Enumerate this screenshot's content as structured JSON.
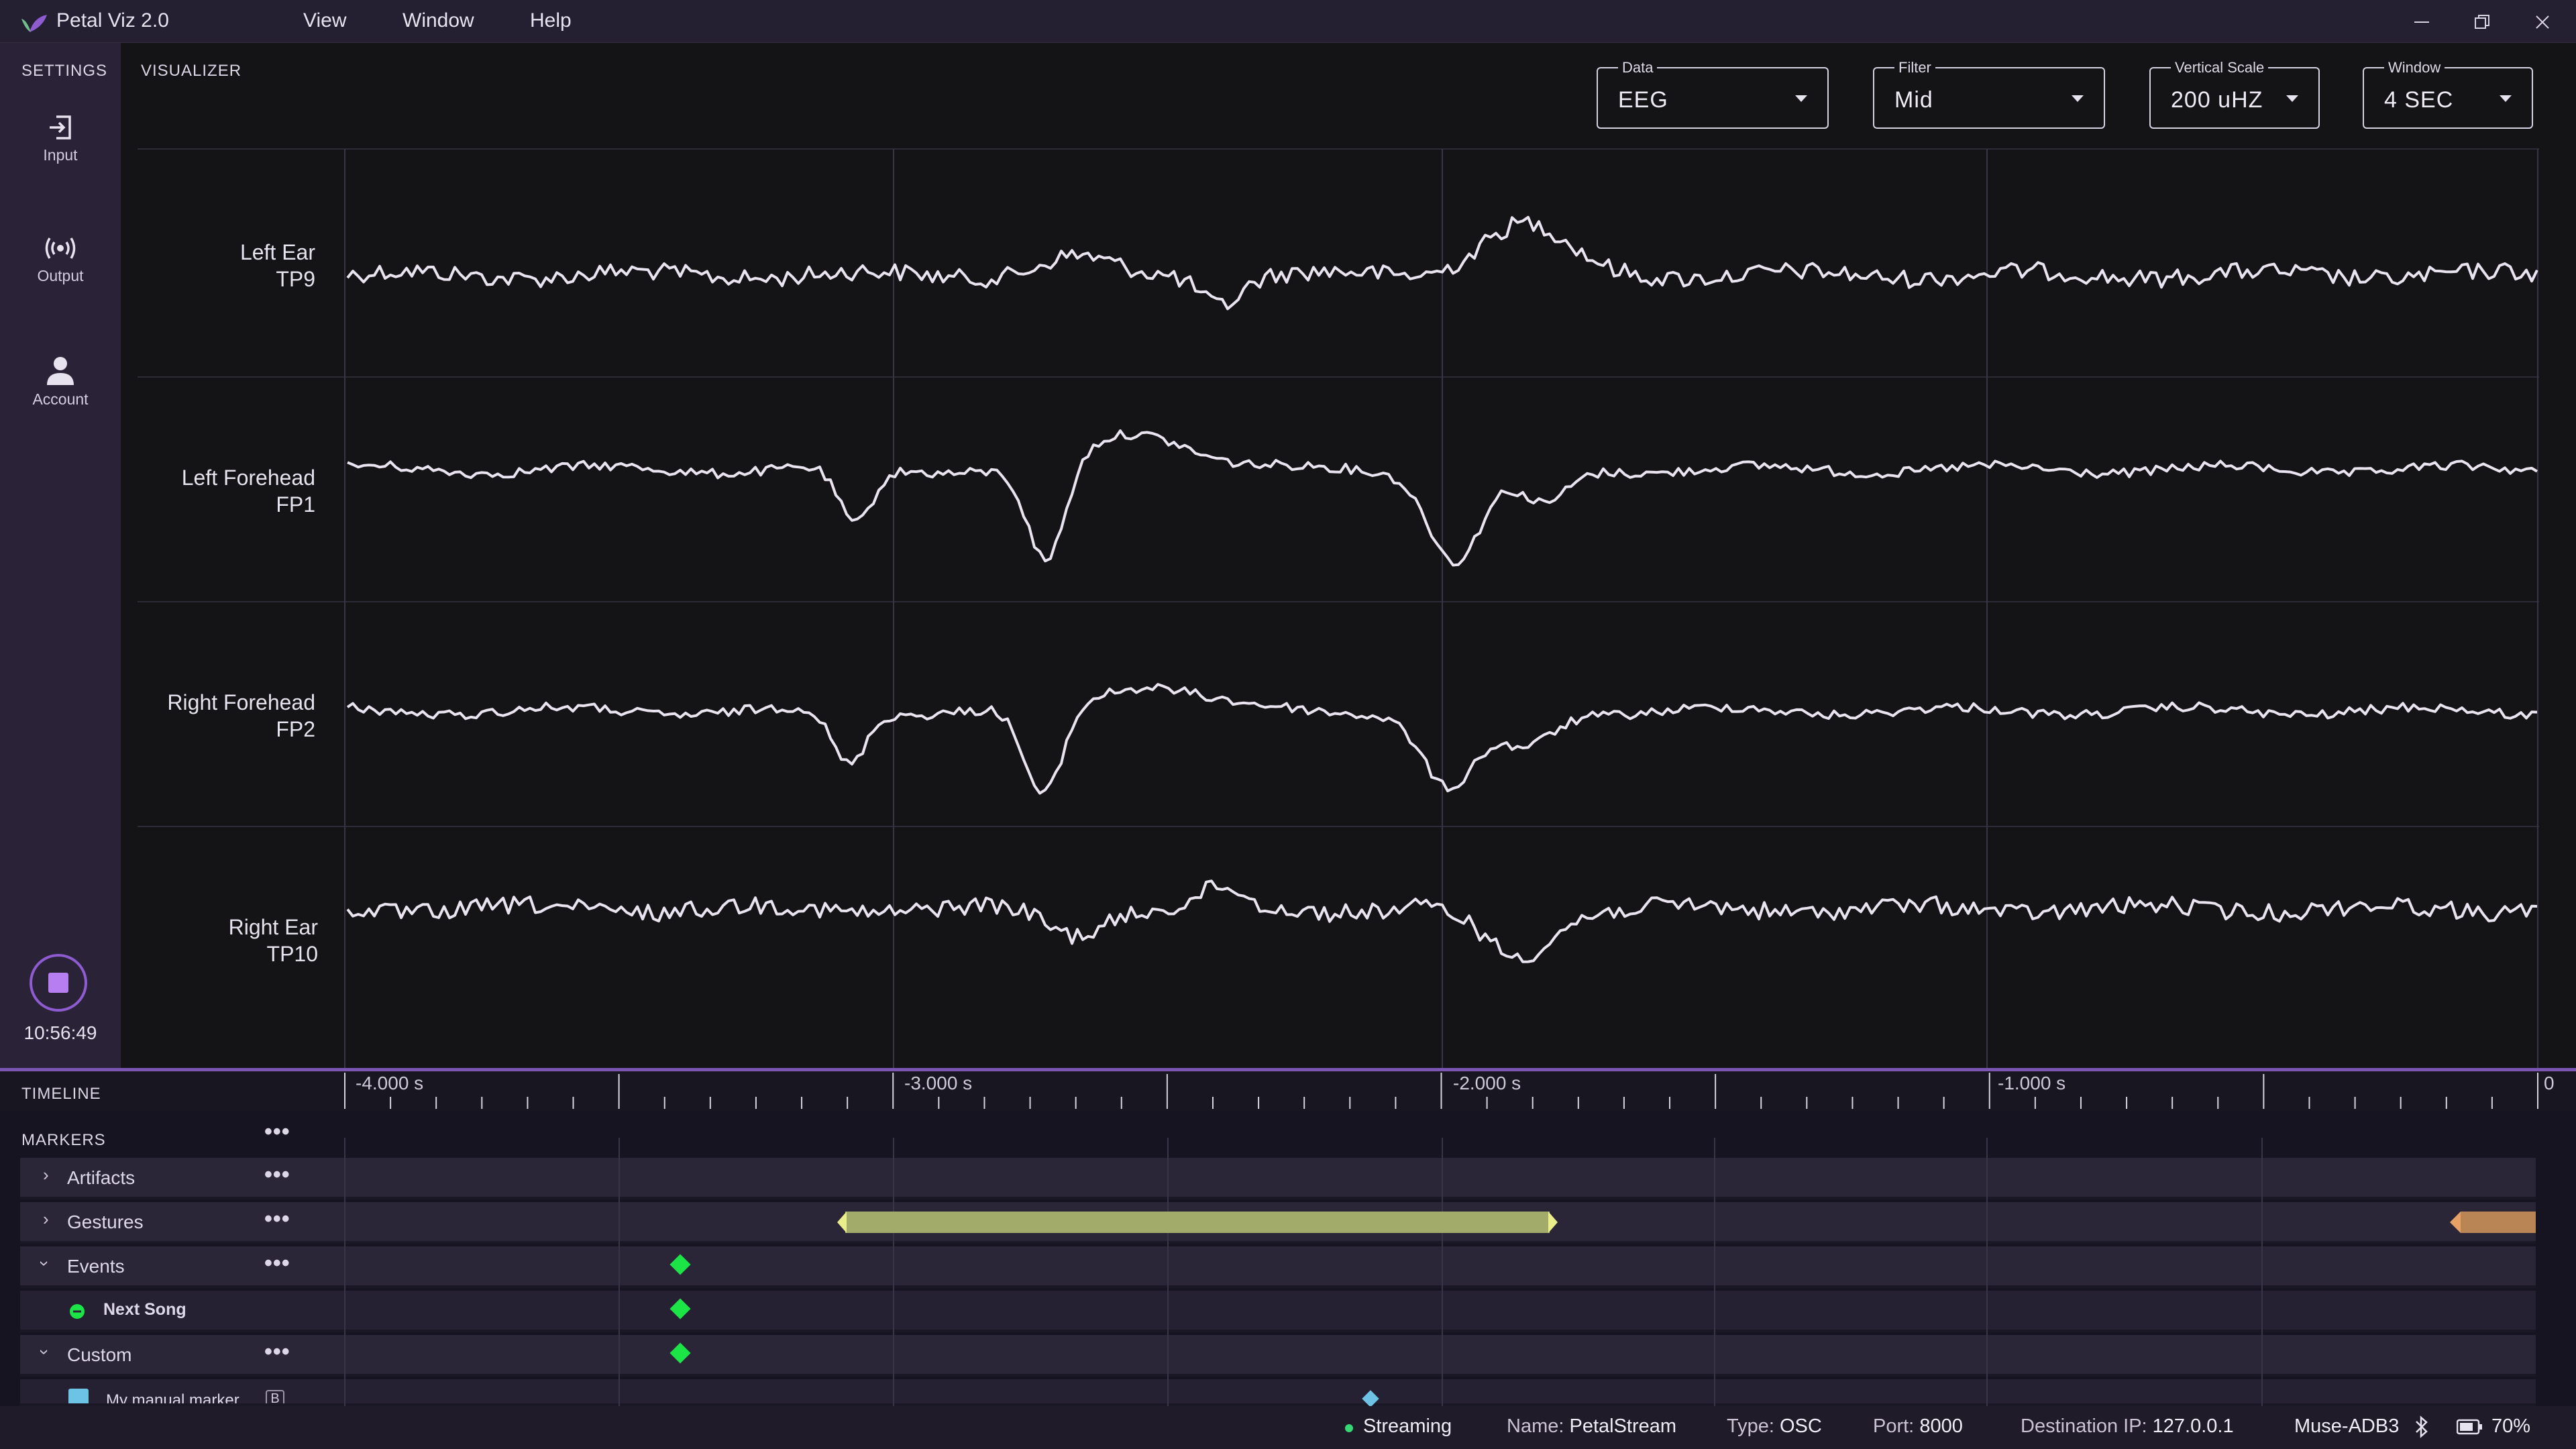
{
  "app": {
    "title": "Petal Viz 2.0"
  },
  "menu": {
    "view": "View",
    "window": "Window",
    "help": "Help"
  },
  "sidebar": {
    "heading": "SETTINGS",
    "items": [
      {
        "label": "Input",
        "icon": "input-icon"
      },
      {
        "label": "Output",
        "icon": "broadcast-icon"
      },
      {
        "label": "Account",
        "icon": "person-icon"
      }
    ],
    "clock": "10:56:49"
  },
  "visualizer": {
    "heading": "VISUALIZER",
    "controls": {
      "data": {
        "label": "Data",
        "value": "EEG"
      },
      "filter": {
        "label": "Filter",
        "value": "Mid"
      },
      "vertical_scale": {
        "label": "Vertical Scale",
        "value": "200 uHZ"
      },
      "window": {
        "label": "Window",
        "value": "4 SEC"
      }
    },
    "channels": [
      {
        "name": "Left Ear",
        "code": "TP9"
      },
      {
        "name": "Left Forehead",
        "code": "FP1"
      },
      {
        "name": "Right Forehead",
        "code": "FP2"
      },
      {
        "name": "Right Ear",
        "code": "TP10"
      }
    ],
    "trace_color": "#e9e4f0"
  },
  "timeline": {
    "heading": "TIMELINE",
    "ticks": [
      "-4.000 s",
      "-3.000 s",
      "-2.000 s",
      "-1.000 s",
      "0"
    ]
  },
  "markers": {
    "heading": "MARKERS",
    "more": "•••",
    "groups": [
      {
        "label": "Artifacts",
        "expanded": false
      },
      {
        "label": "Gestures",
        "expanded": false
      },
      {
        "label": "Events",
        "expanded": true
      },
      {
        "label": "Next Song"
      },
      {
        "label": "Custom",
        "expanded": true
      },
      {
        "label": "My manual marker",
        "key": "B"
      }
    ],
    "colors": {
      "event": "#1ce346",
      "gesture": "#a3ab6a",
      "gesture_end": "#b98555",
      "custom": "#6cc3e4"
    }
  },
  "status": {
    "streaming": "Streaming",
    "name_label": "Name:",
    "name": "PetalStream",
    "type_label": "Type:",
    "type": "OSC",
    "port_label": "Port:",
    "port": "8000",
    "dest_label": "Destination IP:",
    "dest": "127.0.0.1",
    "device": "Muse-ADB3",
    "battery": "70%"
  }
}
